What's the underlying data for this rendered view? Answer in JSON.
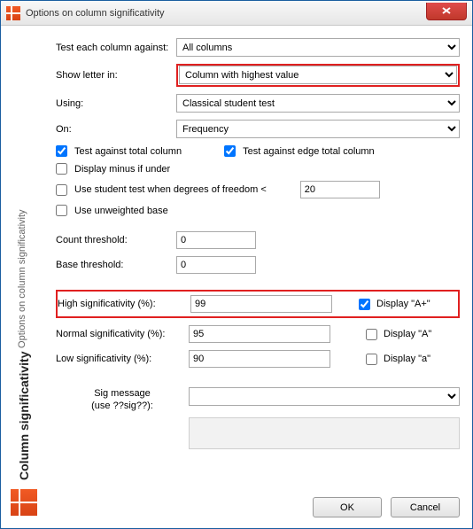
{
  "window": {
    "title": "Options on column significativity",
    "close_label": "Close"
  },
  "sidebar": {
    "main": "Column significativity",
    "sub": "Options on column significativity"
  },
  "labels": {
    "test_against": "Test each column against:",
    "show_letter": "Show letter in:",
    "using": "Using:",
    "on": "On:",
    "count_threshold": "Count threshold:",
    "base_threshold": "Base threshold:",
    "high_sig": "High significativity (%):",
    "normal_sig": "Normal significativity (%):",
    "low_sig": "Low significativity (%):",
    "sig_msg_line1": "Sig message",
    "sig_msg_line2": "(use ??sig??):"
  },
  "selects": {
    "test_against": {
      "value": "All columns"
    },
    "show_letter": {
      "value": "Column with highest value"
    },
    "using": {
      "value": "Classical student test"
    },
    "on": {
      "value": "Frequency"
    },
    "sig_msg": {
      "value": ""
    }
  },
  "checks": {
    "test_total": {
      "label": "Test against total column",
      "checked": true
    },
    "test_edge_total": {
      "label": "Test against edge total column",
      "checked": true
    },
    "display_minus": {
      "label": "Display minus if under",
      "checked": false
    },
    "student_dof": {
      "label": "Use student test when degrees of freedom <",
      "checked": false
    },
    "unweighted": {
      "label": "Use unweighted base",
      "checked": false
    },
    "display_Aplus": {
      "label": "Display \"A+\"",
      "checked": true
    },
    "display_A": {
      "label": "Display \"A\"",
      "checked": false
    },
    "display_a": {
      "label": "Display \"a\"",
      "checked": false
    }
  },
  "inputs": {
    "student_dof_value": "20",
    "count_threshold": "0",
    "base_threshold": "0",
    "high_sig": "99",
    "normal_sig": "95",
    "low_sig": "90"
  },
  "buttons": {
    "ok": "OK",
    "cancel": "Cancel"
  }
}
